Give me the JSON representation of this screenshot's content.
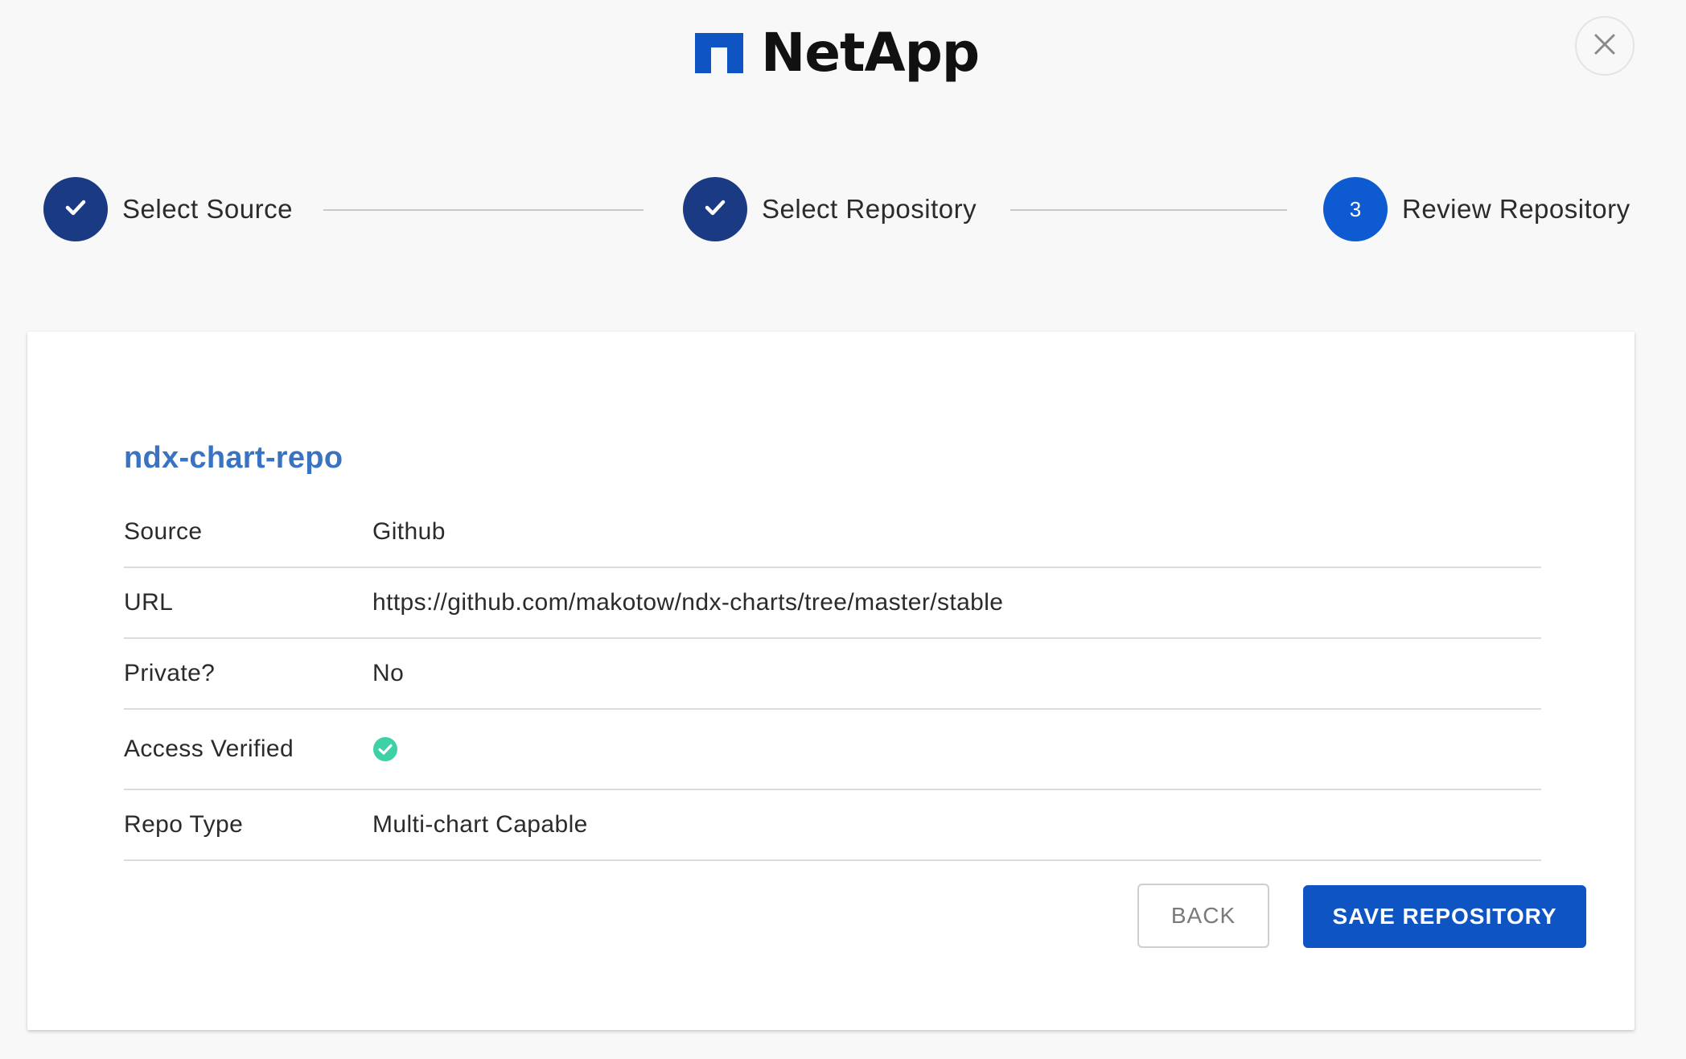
{
  "brand": {
    "name": "NetApp",
    "color": "#0e55c3"
  },
  "header": {
    "close_icon": "close-icon"
  },
  "stepper": {
    "steps": [
      {
        "label": "Select Source",
        "state": "completed",
        "icon": "check-icon"
      },
      {
        "label": "Select Repository",
        "state": "completed",
        "icon": "check-icon"
      },
      {
        "label": "Review Repository",
        "state": "active",
        "number": "3"
      }
    ]
  },
  "repo": {
    "name": "ndx-chart-repo",
    "details": [
      {
        "label": "Source",
        "value": "Github"
      },
      {
        "label": "URL",
        "value": "https://github.com/makotow/ndx-charts/tree/master/stable"
      },
      {
        "label": "Private?",
        "value": "No"
      },
      {
        "label": "Access Verified",
        "value": "",
        "icon": "check-circle-icon",
        "icon_color": "#3ed1a6"
      },
      {
        "label": "Repo Type",
        "value": "Multi-chart Capable"
      }
    ]
  },
  "actions": {
    "back_label": "BACK",
    "save_label": "SAVE REPOSITORY"
  },
  "colors": {
    "step_done": "#1a3a84",
    "step_active": "#0e5bd1",
    "repo_name": "#3a73c2",
    "success": "#3ed1a6"
  }
}
